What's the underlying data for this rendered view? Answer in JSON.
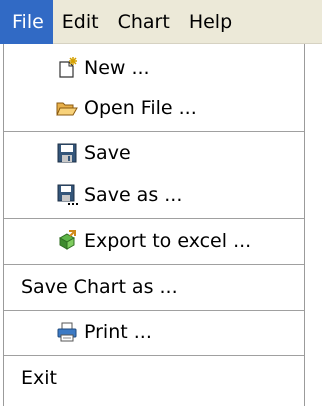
{
  "menubar": {
    "items": [
      {
        "label": "File",
        "active": true
      },
      {
        "label": "Edit"
      },
      {
        "label": "Chart"
      },
      {
        "label": "Help"
      }
    ]
  },
  "file_menu": {
    "new": {
      "label": "New ...",
      "icon": "new-file-icon"
    },
    "open": {
      "label": "Open File ...",
      "icon": "folder-open-icon"
    },
    "save": {
      "label": "Save",
      "icon": "floppy-disk-icon"
    },
    "save_as": {
      "label": "Save as ...",
      "icon": "floppy-disk-saveas-icon"
    },
    "export_excel": {
      "label": "Export to excel ...",
      "icon": "export-icon"
    },
    "save_chart": {
      "label": "Save Chart as ..."
    },
    "print": {
      "label": "Print ...",
      "icon": "printer-icon"
    },
    "exit": {
      "label": "Exit"
    }
  },
  "colors": {
    "menubar_bg": "#ece9d8",
    "active_bg": "#316ac5",
    "active_text": "#ffffff",
    "separator": "#a0a0a0"
  }
}
